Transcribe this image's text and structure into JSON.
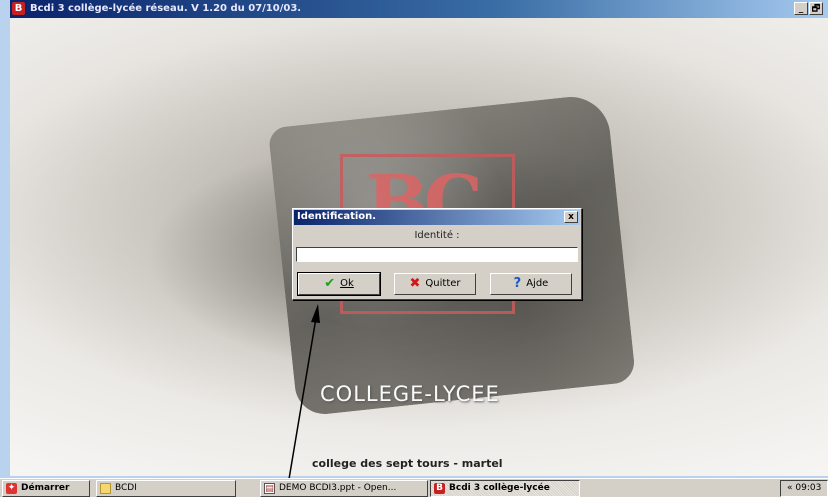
{
  "window": {
    "title": "Bcdi 3 collège-lycée réseau. V 1.20 du 07/10/03.",
    "app_icon_letter": "B",
    "minimize": "_",
    "maximize": "🗗"
  },
  "splash": {
    "logo": "BC",
    "edition": "COLLEGE-LYCEE",
    "school": "college des sept tours - martel"
  },
  "dialog": {
    "title": "Identification.",
    "close": "x",
    "prompt": "Identité :",
    "input_value": "",
    "buttons": {
      "ok": "Ok",
      "quit": "Quitter",
      "help": "Ajde"
    },
    "icons": {
      "ok": "check-icon",
      "quit": "cross-icon",
      "help": "question-icon"
    },
    "colors": {
      "ok": "#1e9e1e",
      "quit": "#d01818",
      "help": "#1c58c8"
    }
  },
  "taskbar": {
    "start": "Démarrer",
    "items": [
      "BCDI",
      "DEMO BCDI3.ppt - Open...",
      "Bcdi 3 collège-lycée"
    ],
    "tray_arrow": "«",
    "clock": "09:03"
  },
  "colors": {
    "titlebar_start": "#0a246a",
    "titlebar_end": "#a6caf0",
    "desktop": "#b9d3ee",
    "logo_red": "#dc6464"
  }
}
